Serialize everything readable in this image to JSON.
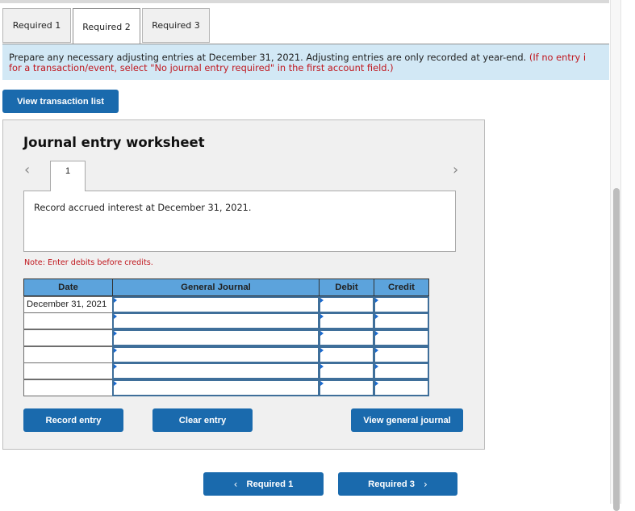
{
  "tabs": [
    {
      "label": "Required 1",
      "active": false
    },
    {
      "label": "Required 2",
      "active": true
    },
    {
      "label": "Required 3",
      "active": false
    }
  ],
  "instructions": {
    "text": "Prepare any necessary adjusting entries at December 31, 2021. Adjusting entries are only recorded at year-end.",
    "note_red_line1": "(If no entry i",
    "note_red_line2": "for a transaction/event, select \"No journal entry required\" in the first account field.)"
  },
  "view_transaction_list_label": "View transaction list",
  "worksheet": {
    "title": "Journal entry worksheet",
    "prev_icon": "chevron-left",
    "next_icon": "chevron-right",
    "entry_number": "1",
    "description": "Record accrued interest at December 31, 2021.",
    "note": "Note: Enter debits before credits.",
    "columns": [
      "Date",
      "General Journal",
      "Debit",
      "Credit"
    ],
    "rows": [
      {
        "date": "December 31, 2021",
        "account": "",
        "debit": "",
        "credit": ""
      },
      {
        "date": "",
        "account": "",
        "debit": "",
        "credit": ""
      },
      {
        "date": "",
        "account": "",
        "debit": "",
        "credit": ""
      },
      {
        "date": "",
        "account": "",
        "debit": "",
        "credit": ""
      },
      {
        "date": "",
        "account": "",
        "debit": "",
        "credit": ""
      },
      {
        "date": "",
        "account": "",
        "debit": "",
        "credit": ""
      }
    ],
    "buttons": {
      "record": "Record entry",
      "clear": "Clear entry",
      "view_general_journal": "View general journal"
    }
  },
  "nav": {
    "prev_label": "Required 1",
    "prev_arrow": "‹",
    "next_label": "Required 3",
    "next_arrow": "›"
  },
  "colors": {
    "primary_button": "#1a6aad",
    "table_header": "#5ca3dc",
    "banner_bg": "#d2e8f5",
    "alert_red": "#c0171e"
  }
}
